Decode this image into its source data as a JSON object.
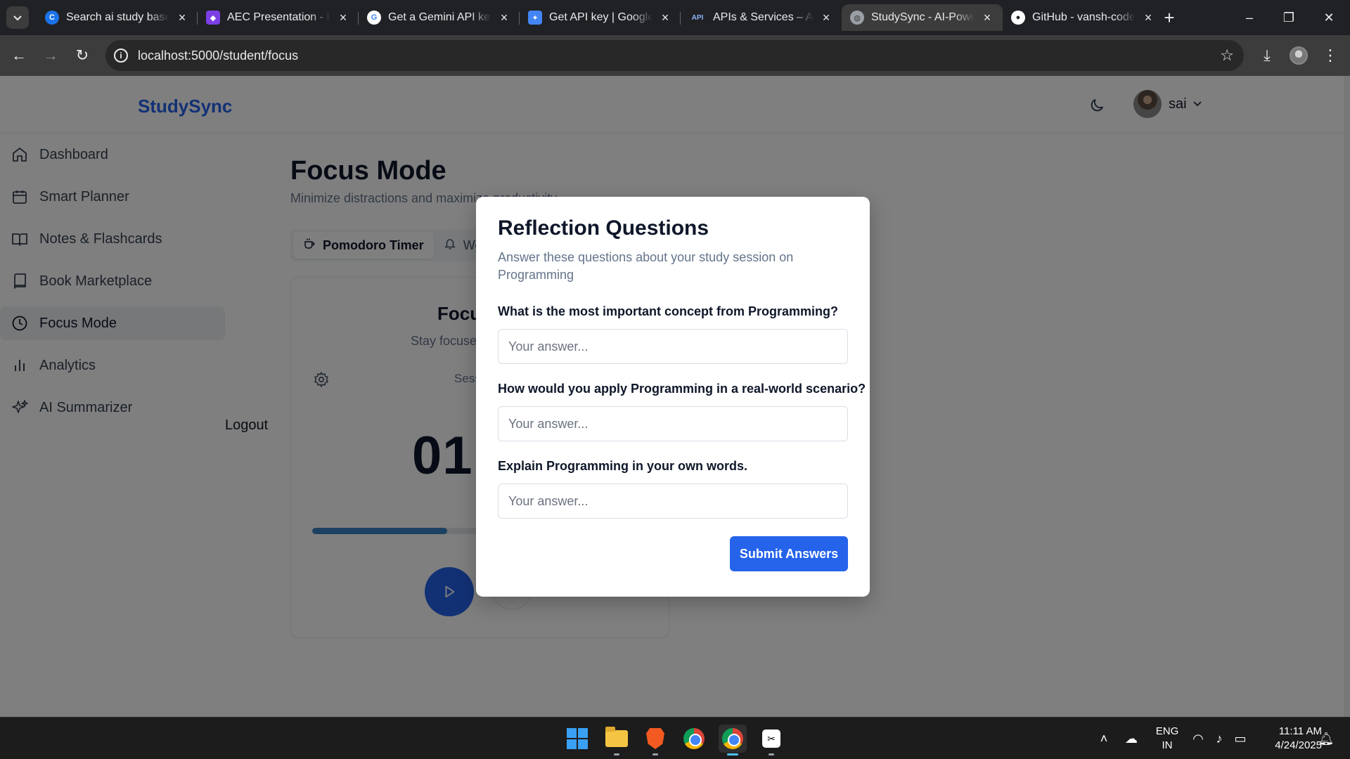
{
  "browser": {
    "tabs": [
      {
        "title": "Search ai study based",
        "favicon": "perplexity-favicon",
        "color": "#1a73e8"
      },
      {
        "title": "AEC Presentation - Pi",
        "favicon": "presentation-favicon",
        "color": "#7b3fe4"
      },
      {
        "title": "Get a Gemini API key",
        "favicon": "google-favicon",
        "color": "#ffffff"
      },
      {
        "title": "Get API key | Google",
        "favicon": "google-ai-studio-favicon",
        "color": "#4285f4"
      },
      {
        "title": "APIs & Services – API",
        "favicon": "api-favicon",
        "color": "#4285f4"
      },
      {
        "title": "StudySync - AI-Powe",
        "favicon": "globe-favicon",
        "color": "#9aa0a6",
        "active": true
      },
      {
        "title": "GitHub - vansh-code",
        "favicon": "github-favicon",
        "color": "#ffffff"
      }
    ],
    "api_favicon_text": "API",
    "url": "localhost:5000/student/focus"
  },
  "app": {
    "brand": "StudySync",
    "user_name": "sai",
    "sidebar": [
      {
        "label": "Dashboard",
        "icon": "home-icon"
      },
      {
        "label": "Smart Planner",
        "icon": "calendar-icon"
      },
      {
        "label": "Notes & Flashcards",
        "icon": "book-open-icon"
      },
      {
        "label": "Book Marketplace",
        "icon": "book-icon"
      },
      {
        "label": "Focus Mode",
        "icon": "clock-icon",
        "active": true
      },
      {
        "label": "Analytics",
        "icon": "bar-chart-icon"
      },
      {
        "label": "AI Summarizer",
        "icon": "sparkles-icon"
      }
    ],
    "logout": "Logout"
  },
  "focus": {
    "title": "Focus Mode",
    "subtitle": "Minimize distractions and maximize productivity",
    "tabs": [
      {
        "label": "Pomodoro Timer",
        "icon": "coffee-icon",
        "active": true
      },
      {
        "label": "We",
        "icon": "bell-icon"
      }
    ],
    "card_title": "Focus",
    "card_subtitle": "Stay focused",
    "session_label": "Sess",
    "time_display": "01:",
    "progress": 0.4
  },
  "modal": {
    "title": "Reflection Questions",
    "description": "Answer these questions about your study session on Programming",
    "questions": [
      {
        "label": "What is the most important concept from Programming?",
        "placeholder": "Your answer..."
      },
      {
        "label": "How would you apply Programming in a real-world scenario?",
        "placeholder": "Your answer..."
      },
      {
        "label": "Explain Programming in your own words.",
        "placeholder": "Your answer..."
      }
    ],
    "submit_label": "Submit Answers"
  },
  "taskbar": {
    "apps": [
      "windows-start",
      "file-explorer",
      "brave",
      "chrome",
      "chrome-profile",
      "capcut"
    ],
    "lang_line1": "ENG",
    "lang_line2": "IN",
    "time": "11:11 AM",
    "date": "4/24/2025"
  }
}
